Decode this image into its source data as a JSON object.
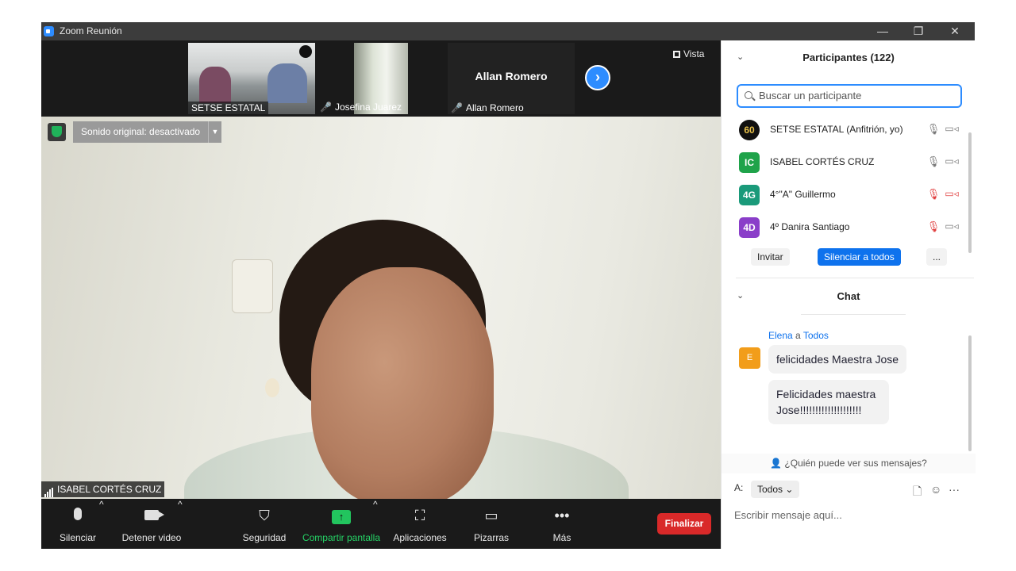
{
  "window": {
    "title": "Zoom Reunión",
    "controls": [
      "—",
      "❐",
      "✕"
    ]
  },
  "thumbnails": [
    {
      "name": "SETSE ESTATAL"
    },
    {
      "name": "Josefina Juarez"
    },
    {
      "name": "Allan Romero",
      "big_name": "Allan Romero"
    }
  ],
  "view": {
    "label": "Vista"
  },
  "video": {
    "sound_original": "Sonido original: desactivado",
    "speaker": "ISABEL CORTÉS CRUZ"
  },
  "toolbar": {
    "mute": "Silenciar",
    "stop_video": "Detener video",
    "security": "Seguridad",
    "share": "Compartir pantalla",
    "apps": "Aplicaciones",
    "whiteboards": "Pizarras",
    "more": "Más",
    "end": "Finalizar"
  },
  "participants": {
    "title": "Participantes (122)",
    "search_placeholder": "Buscar un participante",
    "items": [
      {
        "initials": "60",
        "name": "SETSE ESTATAL (Anfitrión, yo)",
        "color": "#111111",
        "mic_muted": false,
        "cam_off": false
      },
      {
        "initials": "IC",
        "name": "ISABEL CORTÉS CRUZ",
        "color": "#1fa34a",
        "mic_muted": false,
        "cam_off": false
      },
      {
        "initials": "4G",
        "name": "4°\"A\" Guillermo",
        "color": "#1a9a7a",
        "mic_muted": true,
        "cam_off": true
      },
      {
        "initials": "4D",
        "name": "4º Danira Santiago",
        "color": "#8a3ec9",
        "mic_muted": true,
        "cam_off": false
      }
    ],
    "invite": "Invitar",
    "mute_all": "Silenciar a todos",
    "more": "..."
  },
  "chat": {
    "title": "Chat",
    "sender": "Elena",
    "to_word": "a",
    "recipient": "Todos",
    "avatar_initial": "E",
    "messages": [
      "felicidades Maestra Jose",
      "Felicidades maestra Jose!!!!!!!!!!!!!!!!!!!!"
    ],
    "who_can_see": "¿Quién puede ver sus mensajes?",
    "to_label": "A:",
    "to_value": "Todos",
    "input_placeholder": "Escribir mensaje aquí..."
  },
  "colors": {
    "accent": "#0e72ed",
    "end": "#d92929",
    "share": "#22c55e"
  }
}
